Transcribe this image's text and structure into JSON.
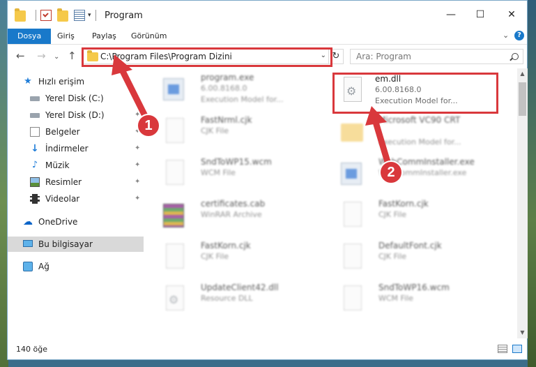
{
  "window": {
    "title": "Program",
    "controls": {
      "minimize": "—",
      "maximize": "☐",
      "close": "✕"
    }
  },
  "ribbon": {
    "tabs": [
      "Dosya",
      "Giriş",
      "Paylaş",
      "Görünüm"
    ],
    "expand": "⌄",
    "help": "?"
  },
  "navigation": {
    "back": "←",
    "forward": "→",
    "recent": "⌄",
    "up": "↑",
    "address": "C:\\Program Files\\Program Dizini",
    "address_dropdown": "⌄",
    "refresh": "↻",
    "search_placeholder": "Ara: Program"
  },
  "sidebar": {
    "quick_access": "Hızlı erişim",
    "items": [
      {
        "label": "Yerel Disk (C:)",
        "icon": "disk-icon",
        "pinned": false
      },
      {
        "label": "Yerel Disk (D:)",
        "icon": "disk-icon",
        "pinned": true
      },
      {
        "label": "Belgeler",
        "icon": "documents-icon",
        "pinned": true
      },
      {
        "label": "İndirmeler",
        "icon": "downloads-icon",
        "pinned": true
      },
      {
        "label": "Müzik",
        "icon": "music-icon",
        "pinned": true
      },
      {
        "label": "Resimler",
        "icon": "pictures-icon",
        "pinned": true
      },
      {
        "label": "Videolar",
        "icon": "videos-icon",
        "pinned": true
      }
    ],
    "onedrive": "OneDrive",
    "this_pc": "Bu bilgisayar",
    "network": "Ağ",
    "pin_glyph": "📌"
  },
  "files": {
    "left": [
      {
        "name": "program.exe",
        "line2": "6.00.8168.0",
        "line3": "Execution Model for...",
        "icon": "exe-icon"
      },
      {
        "name": "FastNrml.cjk",
        "line2": "CJK File",
        "line3": "",
        "icon": "document-icon"
      },
      {
        "name": "SndToWP15.wcm",
        "line2": "WCM File",
        "line3": "",
        "icon": "document-icon"
      },
      {
        "name": "certificates.cab",
        "line2": "WinRAR Archive",
        "line3": "",
        "icon": "archive-icon"
      },
      {
        "name": "FastKorn.cjk",
        "line2": "CJK File",
        "line3": "",
        "icon": "document-icon"
      },
      {
        "name": "UpdateClient42.dll",
        "line2": "Resource DLL",
        "line3": "",
        "icon": "dll-icon"
      }
    ],
    "right": [
      {
        "name": "em.dll",
        "line2": "6.00.8168.0",
        "line3": "Execution Model for...",
        "icon": "dll-icon"
      },
      {
        "name": "Microsoft VC90 CRT",
        "line2": "",
        "line3": "Execution Model for...",
        "icon": "folder-icon"
      },
      {
        "name": "WebCommInstaller.exe",
        "line2": "WebCommInstaller.exe",
        "line3": "",
        "icon": "installer-icon"
      },
      {
        "name": "FastKorn.cjk",
        "line2": "CJK File",
        "line3": "",
        "icon": "document-icon"
      },
      {
        "name": "DefaultFont.cjk",
        "line2": "CJK File",
        "line3": "",
        "icon": "document-icon"
      },
      {
        "name": "SndToWP16.wcm",
        "line2": "WCM File",
        "line3": "",
        "icon": "document-icon"
      }
    ]
  },
  "annotations": {
    "step1": "1",
    "step2": "2",
    "color": "#d9383c"
  },
  "status": {
    "item_count": "140 öğe"
  },
  "colors": {
    "accent": "#1979ca",
    "highlight": "#d9383c"
  }
}
